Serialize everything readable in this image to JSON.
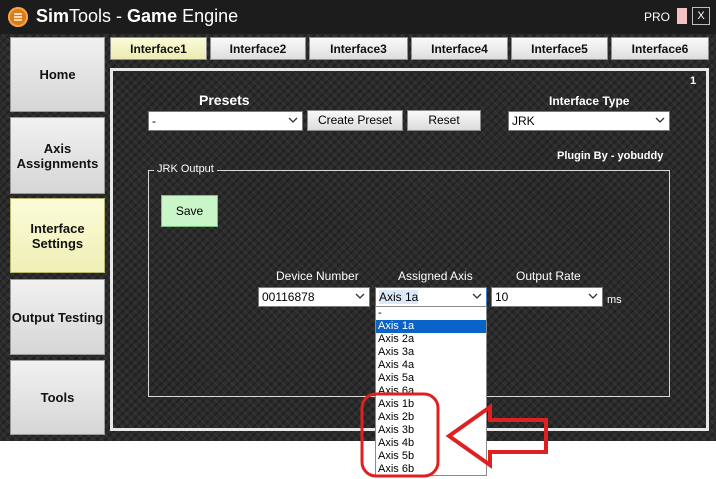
{
  "app": {
    "title_part1": "Sim",
    "title_part2": "Tools - ",
    "title_part3": "Game",
    "title_part4": " Engine",
    "edition": "PRO",
    "close_label": "X"
  },
  "sidebar": {
    "items": [
      {
        "label": "Home",
        "active": false
      },
      {
        "label": "Axis Assignments",
        "active": false
      },
      {
        "label": "Interface Settings",
        "active": true
      },
      {
        "label": "Output Testing",
        "active": false
      },
      {
        "label": "Tools",
        "active": false
      }
    ]
  },
  "tabs": [
    {
      "label": "Interface1",
      "active": true
    },
    {
      "label": "Interface2",
      "active": false
    },
    {
      "label": "Interface3",
      "active": false
    },
    {
      "label": "Interface4",
      "active": false
    },
    {
      "label": "Interface5",
      "active": false
    },
    {
      "label": "Interface6",
      "active": false
    }
  ],
  "panel": {
    "number": "1",
    "presets_label": "Presets",
    "preset_value": "-",
    "create_preset_label": "Create Preset",
    "reset_label": "Reset",
    "interface_type_label": "Interface Type",
    "interface_type_value": "JRK",
    "plugin_credit": "Plugin By - yobuddy"
  },
  "jrk_output": {
    "group_title": "JRK Output",
    "save_label": "Save",
    "device_number_label": "Device Number",
    "device_number_value": "00116878",
    "assigned_axis_label": "Assigned Axis",
    "assigned_axis_value": "Axis 1a",
    "output_rate_label": "Output Rate",
    "output_rate_value": "10",
    "output_rate_unit": "ms"
  },
  "axis_dropdown": {
    "options": [
      "-",
      "Axis 1a",
      "Axis 2a",
      "Axis 3a",
      "Axis 4a",
      "Axis 5a",
      "Axis 6a",
      "Axis 1b",
      "Axis 2b",
      "Axis 3b",
      "Axis 4b",
      "Axis 5b",
      "Axis 6b"
    ],
    "selected": "Axis 1a"
  },
  "colors": {
    "logo_orange": "#e07a12",
    "active_tab": "#fbfbd8",
    "save_green": "#c9f5c9",
    "highlight_blue": "#0a64c8",
    "annotation_red": "#e02020"
  },
  "icons": [
    "simtools-logo-icon",
    "close-icon",
    "chevron-down-icon",
    "arrow-left-icon"
  ]
}
